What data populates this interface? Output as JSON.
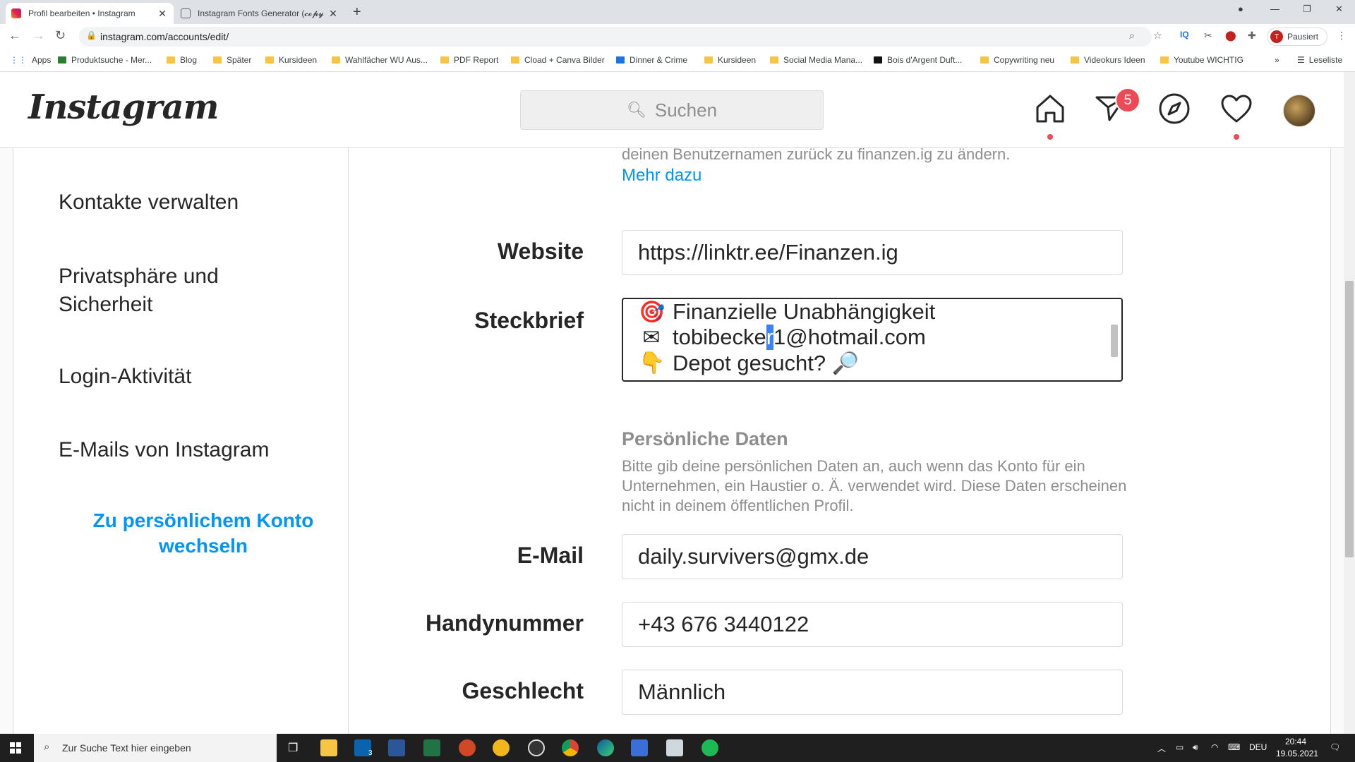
{
  "browser": {
    "tabs": [
      {
        "title": "Profil bearbeiten • Instagram",
        "active": true
      },
      {
        "title": "Instagram Fonts Generator (𝓬𝓸𝓹𝔂",
        "active": false
      }
    ],
    "url": "instagram.com/accounts/edit/",
    "profile_status": "Pausiert",
    "profile_initial": "T",
    "bookmarks": [
      "Apps",
      "Produktsuche - Mer...",
      "Blog",
      "Später",
      "Kursideen",
      "Wahlfächer WU Aus...",
      "PDF Report",
      "Cload + Canva Bilder",
      "Dinner & Crime",
      "Kursideen",
      "Social Media Mana...",
      "Bois d'Argent Duft...",
      "Copywriting neu",
      "Videokurs Ideen",
      "Youtube WICHTIG"
    ],
    "reading_list": "Leseliste"
  },
  "header": {
    "logo": "Instagram",
    "search_placeholder": "Suchen",
    "notification_count": "5"
  },
  "sidebar": {
    "items": [
      "Kontakte verwalten",
      "Privatsphäre und Sicherheit",
      "Login-Aktivität",
      "E-Mails von Instagram"
    ],
    "switch_link": "Zu persönlichem Konto wechseln"
  },
  "form": {
    "username_help": "deinen Benutzernamen zurück zu finanzen.ig zu ändern.",
    "more_link": "Mehr dazu",
    "website_label": "Website",
    "website_value": "https://linktr.ee/Finanzen.ig",
    "bio_label": "Steckbrief",
    "bio_lines": [
      {
        "icon": "🎯",
        "text": "Finanzielle Unabhängigkeit"
      },
      {
        "icon": "✉",
        "pre": "tobibecke",
        "sel": "r",
        "post": "1@hotmail.com"
      },
      {
        "icon": "👇",
        "text": "Depot gesucht? 🔎"
      }
    ],
    "personal_title": "Persönliche Daten",
    "personal_desc": "Bitte gib deine persönlichen Daten an, auch wenn das Konto für ein Unternehmen, ein Haustier o. Ä. verwendet wird. Diese Daten erscheinen nicht in deinem öffentlichen Profil.",
    "email_label": "E-Mail",
    "email_value": "daily.survivers@gmx.de",
    "phone_label": "Handynummer",
    "phone_value": "+43 676 3440122",
    "gender_label": "Geschlecht",
    "gender_value": "Männlich"
  },
  "taskbar": {
    "search_placeholder": "Zur Suche Text hier eingeben",
    "mail_count": "3",
    "language": "DEU",
    "time": "20:44",
    "date": "19.05.2021"
  }
}
